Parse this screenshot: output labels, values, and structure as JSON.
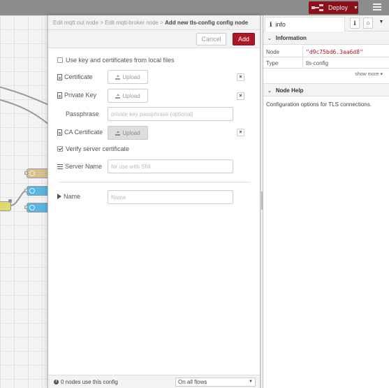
{
  "header": {
    "deploy_label": "Deploy",
    "deploy_color": "#8c101c"
  },
  "tray": {
    "breadcrumb": {
      "crumb1": "Edit mqtt out node",
      "sep1": ">",
      "crumb2": "Edit mqtt-broker node",
      "sep2": ">",
      "current": "Add new tls-config config node"
    },
    "cancel_label": "Cancel",
    "add_label": "Add",
    "use_local_files_label": "Use key and certificates from local files",
    "use_local_files_checked": false,
    "certificate_label": "Certificate",
    "private_key_label": "Private Key",
    "passphrase_label": "Passphrase",
    "passphrase_placeholder": "private key passphrase (optional)",
    "ca_certificate_label": "CA Certificate",
    "upload_label": "Upload",
    "clear_glyph": "×",
    "verify_label": "Verify server certificate",
    "verify_checked": true,
    "server_name_label": "Server Name",
    "server_name_placeholder": "for use with SNI",
    "name_label": "Name",
    "name_placeholder": "Name",
    "footer_usage": "0 nodes use this config",
    "footer_scope": "On all flows"
  },
  "sidebar": {
    "tab_label": "info",
    "information_title": "Information",
    "props": [
      {
        "key": "Node",
        "value": "\"d9c75bd6.3aa6d8\""
      },
      {
        "key": "Type",
        "value": "tls-config"
      }
    ],
    "show_more": "show more ▾",
    "node_help_title": "Node Help",
    "help_text": "Configuration options for TLS connections."
  },
  "colors": {
    "accent": "#ad1625",
    "header_bg": "#8d8d8d"
  }
}
